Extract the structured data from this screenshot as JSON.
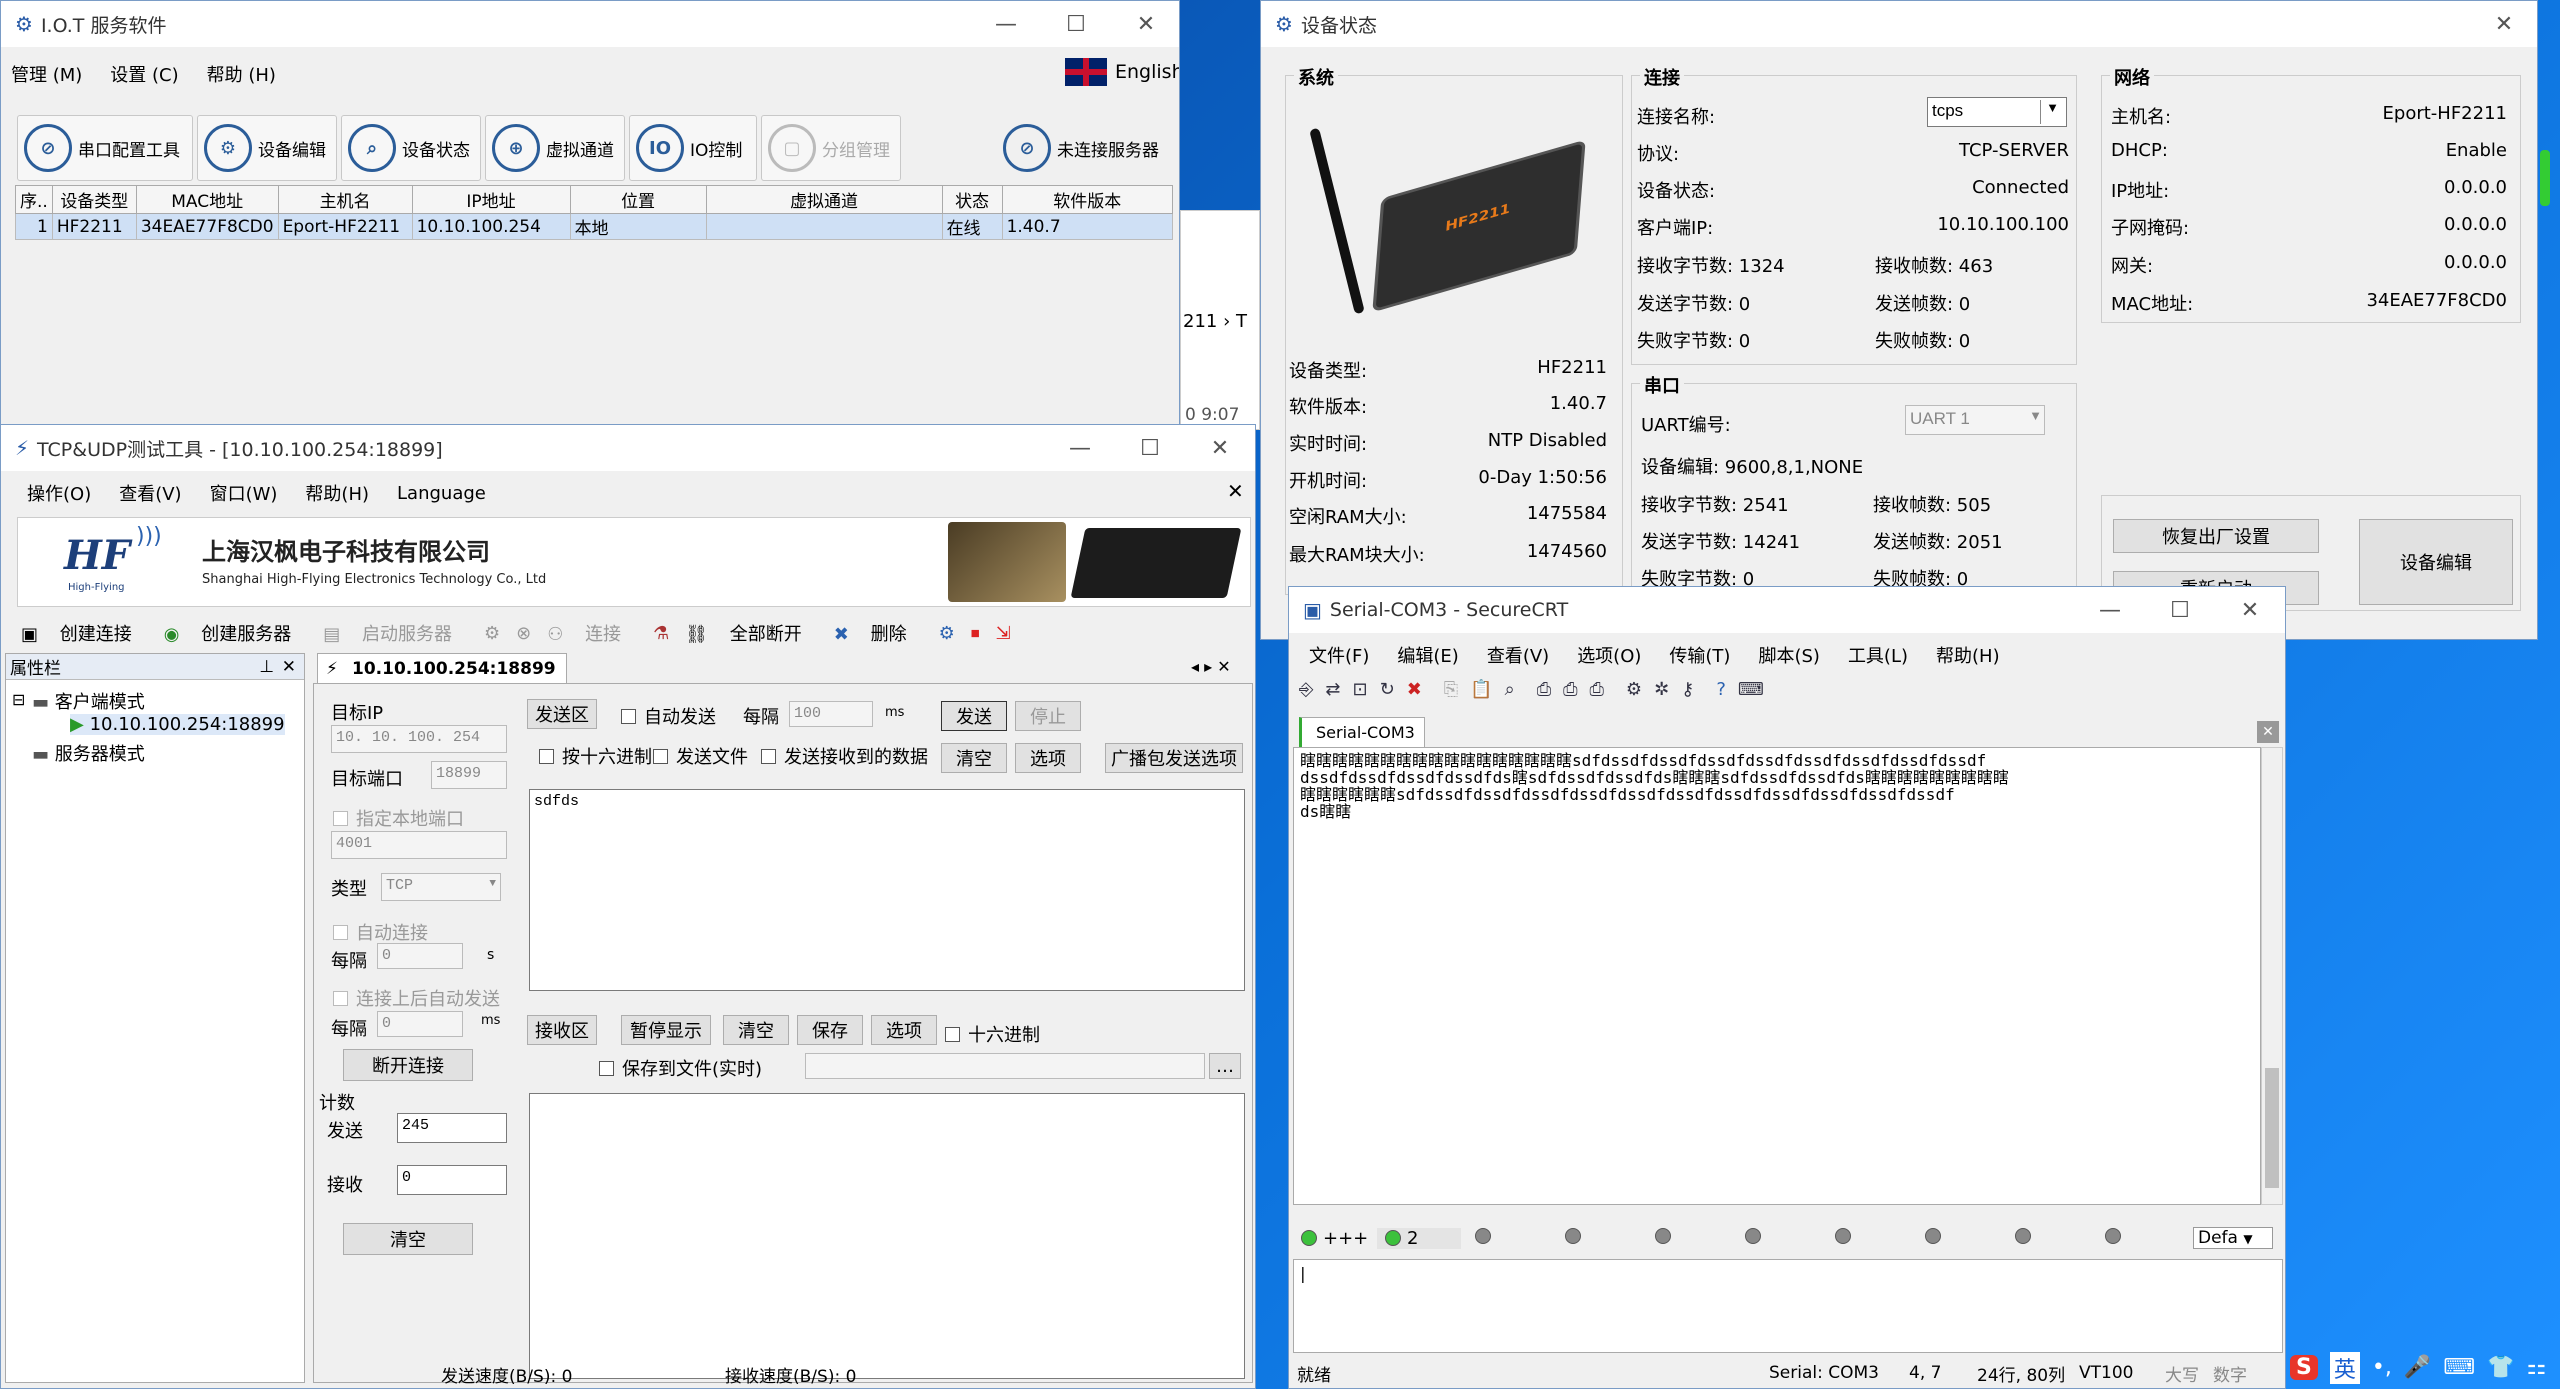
{
  "iot": {
    "title": "I.O.T 服务软件",
    "menu": [
      "管理 (M)",
      "设置 (C)",
      "帮助 (H)"
    ],
    "lang": "English",
    "toolbar": [
      "串口配置工具",
      "设备编辑",
      "设备状态",
      "虚拟通道",
      "IO控制",
      "分组管理",
      "未连接服务器"
    ],
    "columns": [
      "序..",
      "设备类型",
      "MAC地址",
      "主机名",
      "IP地址",
      "位置",
      "虚拟通道",
      "状态",
      "软件版本"
    ],
    "row": [
      "1",
      "HF2211",
      "34EAE77F8CD0",
      "Eport-HF2211",
      "10.10.100.254",
      "本地",
      "",
      "在线",
      "1.40.7"
    ],
    "behind": "211 ›  T",
    "behind_time": "0 9:07"
  },
  "dev": {
    "title": "设备状态",
    "sys": {
      "heading": "系统",
      "device_label": "HF2211",
      "rows": [
        [
          "设备类型:",
          "HF2211"
        ],
        [
          "软件版本:",
          "1.40.7"
        ],
        [
          "实时时间:",
          "NTP Disabled"
        ],
        [
          "开机时间:",
          "0-Day 1:50:56"
        ],
        [
          "空闲RAM大小:",
          "1475584"
        ],
        [
          "最大RAM块大小:",
          "1474560"
        ]
      ]
    },
    "conn": {
      "heading": "连接",
      "name_label": "连接名称:",
      "name_value": "tcps",
      "rows": [
        [
          "协议:",
          "TCP-SERVER"
        ],
        [
          "设备状态:",
          "Connected"
        ],
        [
          "客户端IP:",
          "10.10.100.100"
        ]
      ],
      "pairs": [
        [
          "接收字节数: 1324",
          "接收帧数: 463"
        ],
        [
          "发送字节数: 0",
          "发送帧数: 0"
        ],
        [
          "失败字节数: 0",
          "失败帧数: 0"
        ]
      ]
    },
    "serial": {
      "heading": "串口",
      "uart_label": "UART编号:",
      "uart_value": "UART 1",
      "edit": "设备编辑: 9600,8,1,NONE",
      "pairs": [
        [
          "接收字节数: 2541",
          "接收帧数: 505"
        ],
        [
          "发送字节数: 14241",
          "发送帧数: 2051"
        ],
        [
          "失败字节数: 0",
          "失败帧数: 0"
        ]
      ]
    },
    "net": {
      "heading": "网络",
      "rows": [
        [
          "主机名:",
          "Eport-HF2211"
        ],
        [
          "DHCP:",
          "Enable"
        ],
        [
          "IP地址:",
          "0.0.0.0"
        ],
        [
          "子网掩码:",
          "0.0.0.0"
        ],
        [
          "网关:",
          "0.0.0.0"
        ],
        [
          "MAC地址:",
          "34EAE77F8CD0"
        ]
      ]
    },
    "buttons": {
      "reset": "恢复出厂设置",
      "restart": "重新启动",
      "edit": "设备编辑"
    }
  },
  "tcp": {
    "title": "TCP&UDP测试工具 - [10.10.100.254:18899]",
    "menu": [
      "操作(O)",
      "查看(V)",
      "窗口(W)",
      "帮助(H)",
      "Language"
    ],
    "banner_cn": "上海汉枫电子科技有限公司",
    "banner_en": "Shanghai High-Flying Electronics Technology Co., Ltd",
    "logo": "HF",
    "logo_sub": "High-Flying",
    "toolbar": [
      "创建连接",
      "创建服务器",
      "启动服务器",
      "",
      "",
      "连接",
      "",
      "全部断开",
      "删除"
    ],
    "props": "属性栏",
    "tree": [
      "客户端模式",
      "10.10.100.254:18899",
      "服务器模式"
    ],
    "tab": "10.10.100.254:18899",
    "target_ip_label": "目标IP",
    "target_ip": "10. 10. 100. 254",
    "target_port_label": "目标端口",
    "target_port": "18899",
    "local_port_chk": "指定本地端口",
    "local_port": "4001",
    "type_label": "类型",
    "type": "TCP",
    "auto_conn": "自动连接",
    "every": "每隔",
    "zero": "0",
    "s": "s",
    "ms": "ms",
    "auto_send_after": "连接上后自动发送",
    "disconnect": "断开连接",
    "count": "计数",
    "send_label": "发送",
    "send_val": "245",
    "recv_label": "接收",
    "recv_val": "0",
    "clear": "清空",
    "send_area": "发送区",
    "auto_send": "自动发送",
    "interval": "100",
    "send": "发送",
    "stop": "停止",
    "hex_send": "按十六进制",
    "send_file": "发送文件",
    "send_recv": "发送接收到的数据",
    "options": "选项",
    "broadcast": "广播包发送选项",
    "send_text": "sdfds",
    "recv_area": "接收区",
    "pause": "暂停显示",
    "save": "保存",
    "hex": "十六进制",
    "save_file": "保存到文件(实时)",
    "speed_send": "发送速度(B/S): 0",
    "speed_recv": "接收速度(B/S): 0"
  },
  "crt": {
    "title": "Serial-COM3 - SecureCRT",
    "menu": [
      "文件(F)",
      "编辑(E)",
      "查看(V)",
      "选项(O)",
      "传输(T)",
      "脚本(S)",
      "工具(L)",
      "帮助(H)"
    ],
    "tab": "Serial-COM3",
    "lines": [
      "瞎瞎瞎瞎瞎瞎瞎瞎瞎瞎瞎瞎瞎瞎瞎瞎瞎sdfdssdfdssdfdssdfdssdfdssdfdssdfdssdfdssdf",
      "dssdfdssdfdssdfdssdfds瞎sdfdssdfdssdfds瞎瞎瞎sdfdssdfdssdfds瞎瞎瞎瞎瞎瞎瞎瞎瞎",
      "瞎瞎瞎瞎瞎瞎sdfdssdfdssdfdssdfdssdfdssdfdssdfdssdfdssdfdssdfdssdfdssdf",
      "ds瞎瞎"
    ],
    "btn1": "+++",
    "btn2": "2",
    "defa": "Defa",
    "status": "就绪",
    "status_right": [
      "Serial: COM3",
      "4,  7",
      "24行, 80列",
      "VT100",
      "大写",
      "数字"
    ]
  },
  "tray": {
    "ime": "英"
  }
}
